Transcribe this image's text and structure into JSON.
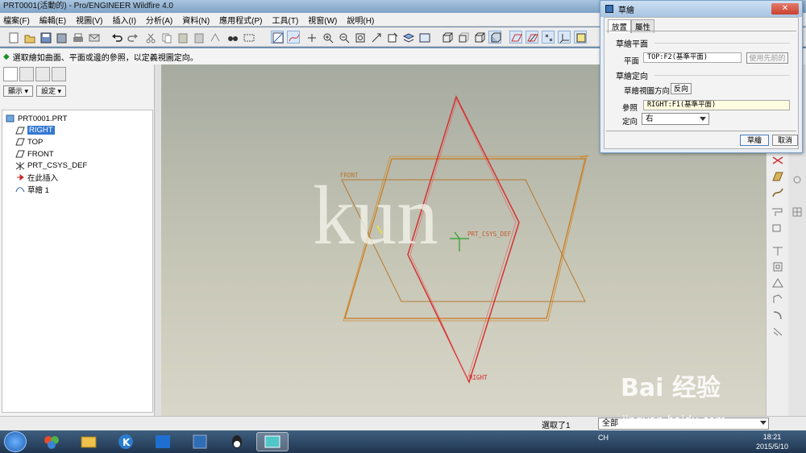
{
  "window": {
    "title": "PRT0001(活動的) - Pro/ENGINEER Wildfire 4.0"
  },
  "menu": [
    "檔案(F)",
    "編輯(E)",
    "視圖(V)",
    "插入(I)",
    "分析(A)",
    "資料(N)",
    "應用程式(P)",
    "工具(T)",
    "視窗(W)",
    "說明(H)"
  ],
  "message": "選取繪如曲面、平面或邊的參照，以定義視圖定向。",
  "panel": {
    "show_btn": "顯示 ▾",
    "settings_btn": "設定 ▾",
    "tree": [
      {
        "label": "PRT0001.PRT",
        "icon": "part-icon",
        "selected": false
      },
      {
        "label": "RIGHT",
        "icon": "datum-plane-icon",
        "selected": true
      },
      {
        "label": "TOP",
        "icon": "datum-plane-icon",
        "selected": false
      },
      {
        "label": "FRONT",
        "icon": "datum-plane-icon",
        "selected": false
      },
      {
        "label": "PRT_CSYS_DEF",
        "icon": "csys-icon",
        "selected": false
      },
      {
        "label": "在此插入",
        "icon": "insert-arrow-icon",
        "selected": false
      },
      {
        "label": "草繪 1",
        "icon": "sketch-icon",
        "selected": false
      }
    ]
  },
  "viewport": {
    "labels": {
      "front": "FRONT",
      "csys": "PRT_CSYS_DEF",
      "right": "RIGHT"
    },
    "watermark": "kun",
    "colors": {
      "right_plane": "#d42a2a",
      "datum_plane": "#c87a1e",
      "csys": "#2aa02a"
    }
  },
  "status": {
    "selected": "選取了1",
    "filter": "全部"
  },
  "dialog": {
    "title": "草繪",
    "tabs": [
      "放置",
      "屬性"
    ],
    "sketch_plane_section": "草繪平面",
    "plane_label": "平面",
    "plane_value": "TOP:F2(基準平面)",
    "use_prev_btn": "使用先前的",
    "orientation_section": "草繪定向",
    "view_dir_label": "草繪視圖方向",
    "flip_btn": "反向",
    "reference_label": "參照",
    "reference_value": "RIGHT:F1(基準平面)",
    "orient_label": "定向",
    "orient_value": "右",
    "sketch_btn": "草繪",
    "cancel_btn": "取消"
  },
  "taskbar": {
    "tray_lang": "CH",
    "time": "18:21",
    "date": "2015/5/10"
  },
  "overlay": {
    "brand": "Bai 经验",
    "url": "jingyan.baidu.com"
  }
}
